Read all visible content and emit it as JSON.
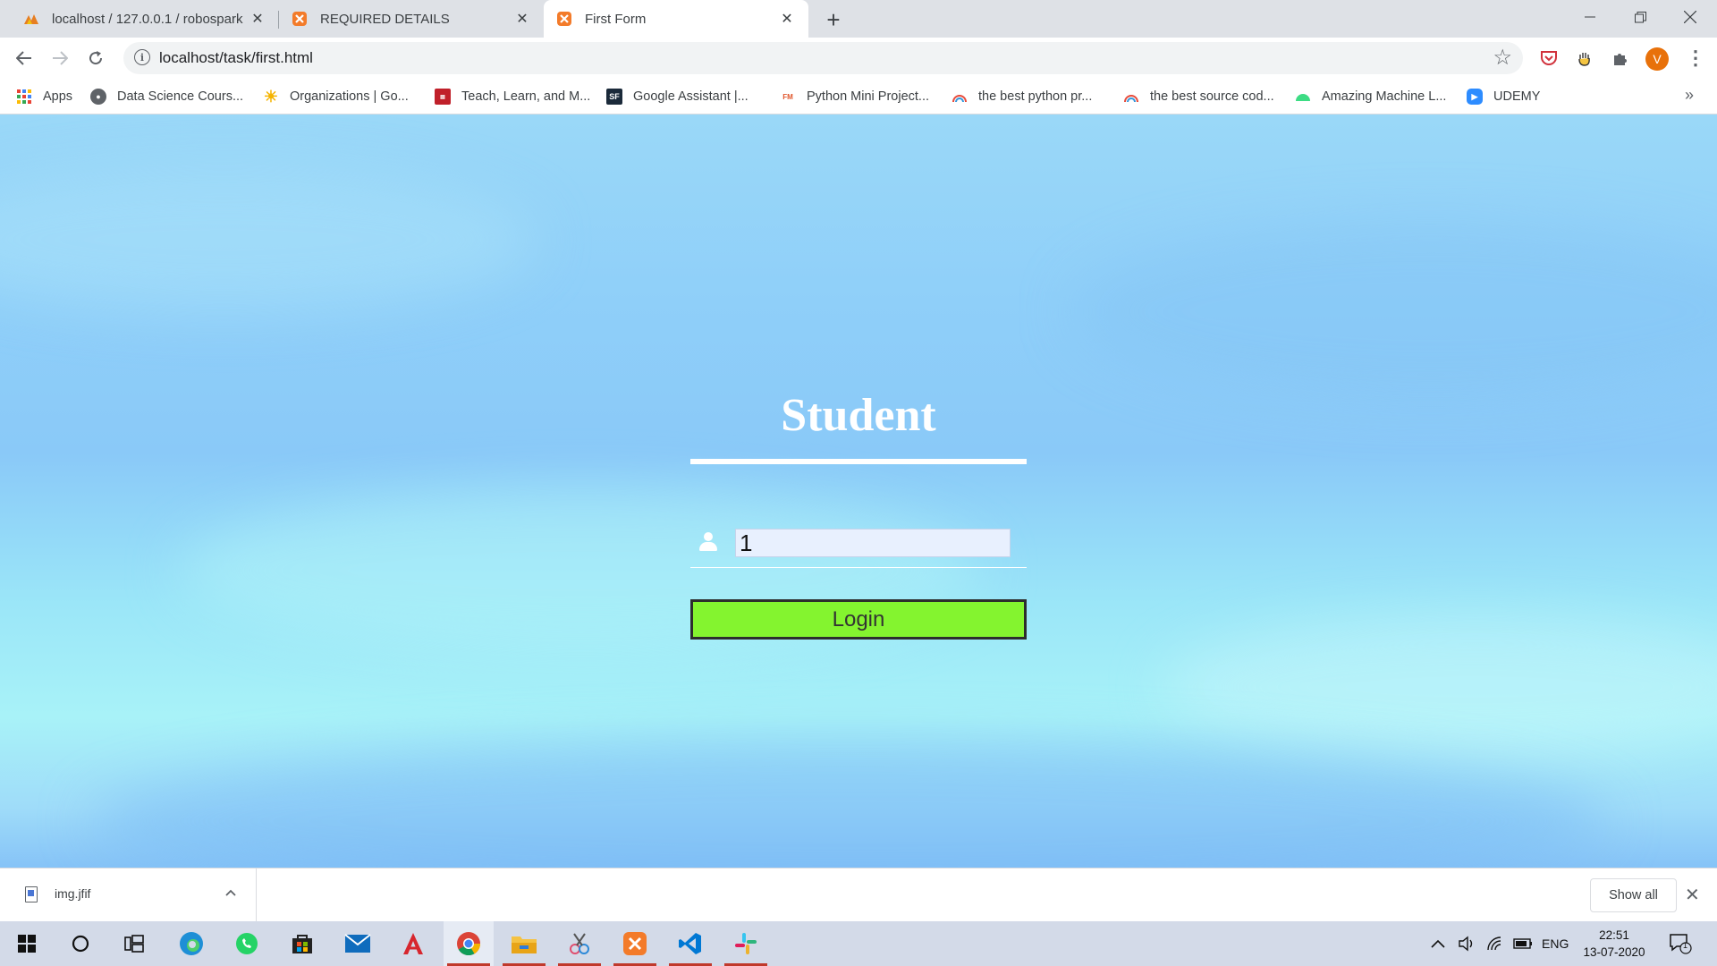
{
  "browser": {
    "tabs": [
      {
        "title": "localhost / 127.0.0.1 / robospark",
        "icon": "phpmyadmin-icon",
        "active": false
      },
      {
        "title": "REQUIRED DETAILS",
        "icon": "xampp-icon",
        "active": false
      },
      {
        "title": "First Form",
        "icon": "xampp-icon",
        "active": true
      }
    ],
    "url": "localhost/task/first.html",
    "profile_initial": "V"
  },
  "bookmarks": [
    {
      "label": "Apps",
      "icon": "apps-grid-icon"
    },
    {
      "label": "Data Science Cours...",
      "icon": "globe-icon"
    },
    {
      "label": "Organizations | Go...",
      "icon": "sun-icon"
    },
    {
      "label": "Teach, Learn, and M...",
      "icon": "red-book-icon"
    },
    {
      "label": "Google Assistant |...",
      "icon": "sf-icon"
    },
    {
      "label": "Python Mini Project...",
      "icon": "fm-icon"
    },
    {
      "label": "the best python pr...",
      "icon": "rainbow-icon"
    },
    {
      "label": "the best source cod...",
      "icon": "rainbow-icon"
    },
    {
      "label": "Amazing Machine L...",
      "icon": "android-icon"
    },
    {
      "label": "UDEMY",
      "icon": "zoom-icon"
    }
  ],
  "form": {
    "title": "Student",
    "field_value": "1",
    "login_label": "Login"
  },
  "downloads": {
    "file_name": "img.jfif",
    "show_all_label": "Show all"
  },
  "taskbar": {
    "language": "ENG",
    "time": "22:51",
    "date": "13-07-2020",
    "notification_count": "1"
  },
  "colors": {
    "login_button": "#84f42f",
    "sky_top": "#9ad8f8",
    "sky_bottom": "#a8f2f8",
    "profile_avatar": "#e8710a"
  }
}
